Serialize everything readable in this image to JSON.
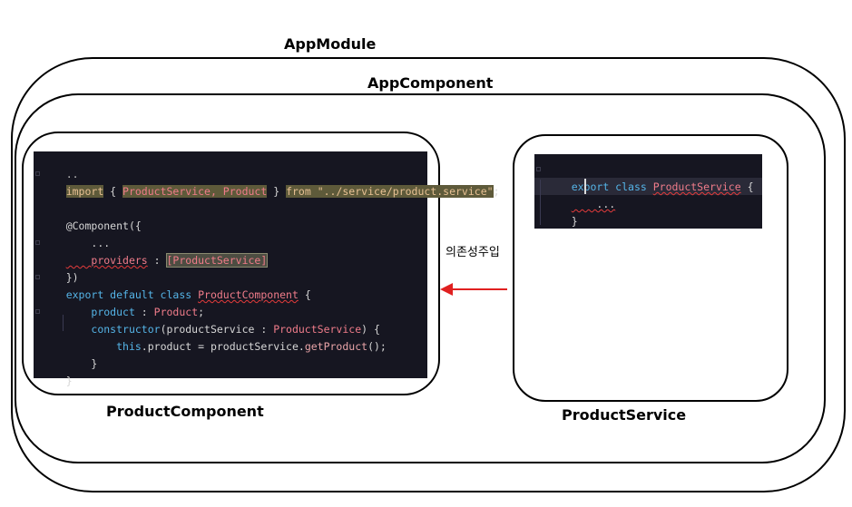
{
  "modules": {
    "app_module": "AppModule",
    "app_component": "AppComponent",
    "product_component": "ProductComponent",
    "product_service": "ProductService"
  },
  "arrow": {
    "label": "의존성주입",
    "color": "#e02020"
  },
  "product_component_code": {
    "line0": "..",
    "line1_import": "import",
    "line1_brace_open": " { ",
    "line1_names": "ProductService, Product",
    "line1_brace_close": " } ",
    "line1_from": "from",
    "line1_path": " \"../service/product.service\"",
    "line1_semi": ";",
    "line3": "@Component({",
    "line4": "    ...",
    "line5_key": "    providers",
    "line5_colon": " : ",
    "line5_value": "[ProductService]",
    "line6": "})",
    "line7_kw": "export default class ",
    "line7_cls": "ProductComponent",
    "line7_rest": " {",
    "line8_prop": "    product",
    "line8_colon": " : ",
    "line8_type": "Product",
    "line8_semi": ";",
    "line9_kw": "    constructor",
    "line9_open": "(productService : ",
    "line9_type": "ProductService",
    "line9_close": ") {",
    "line10_this": "        this",
    "line10_mid": ".product = productService.",
    "line10_fn": "getProduct",
    "line10_end": "();",
    "line11": "    }",
    "line12": "}"
  },
  "product_service_code": {
    "line1_kw": "export class ",
    "line1_cls": "ProductService",
    "line1_rest": " {",
    "line2": "    ...",
    "line3": "}"
  }
}
